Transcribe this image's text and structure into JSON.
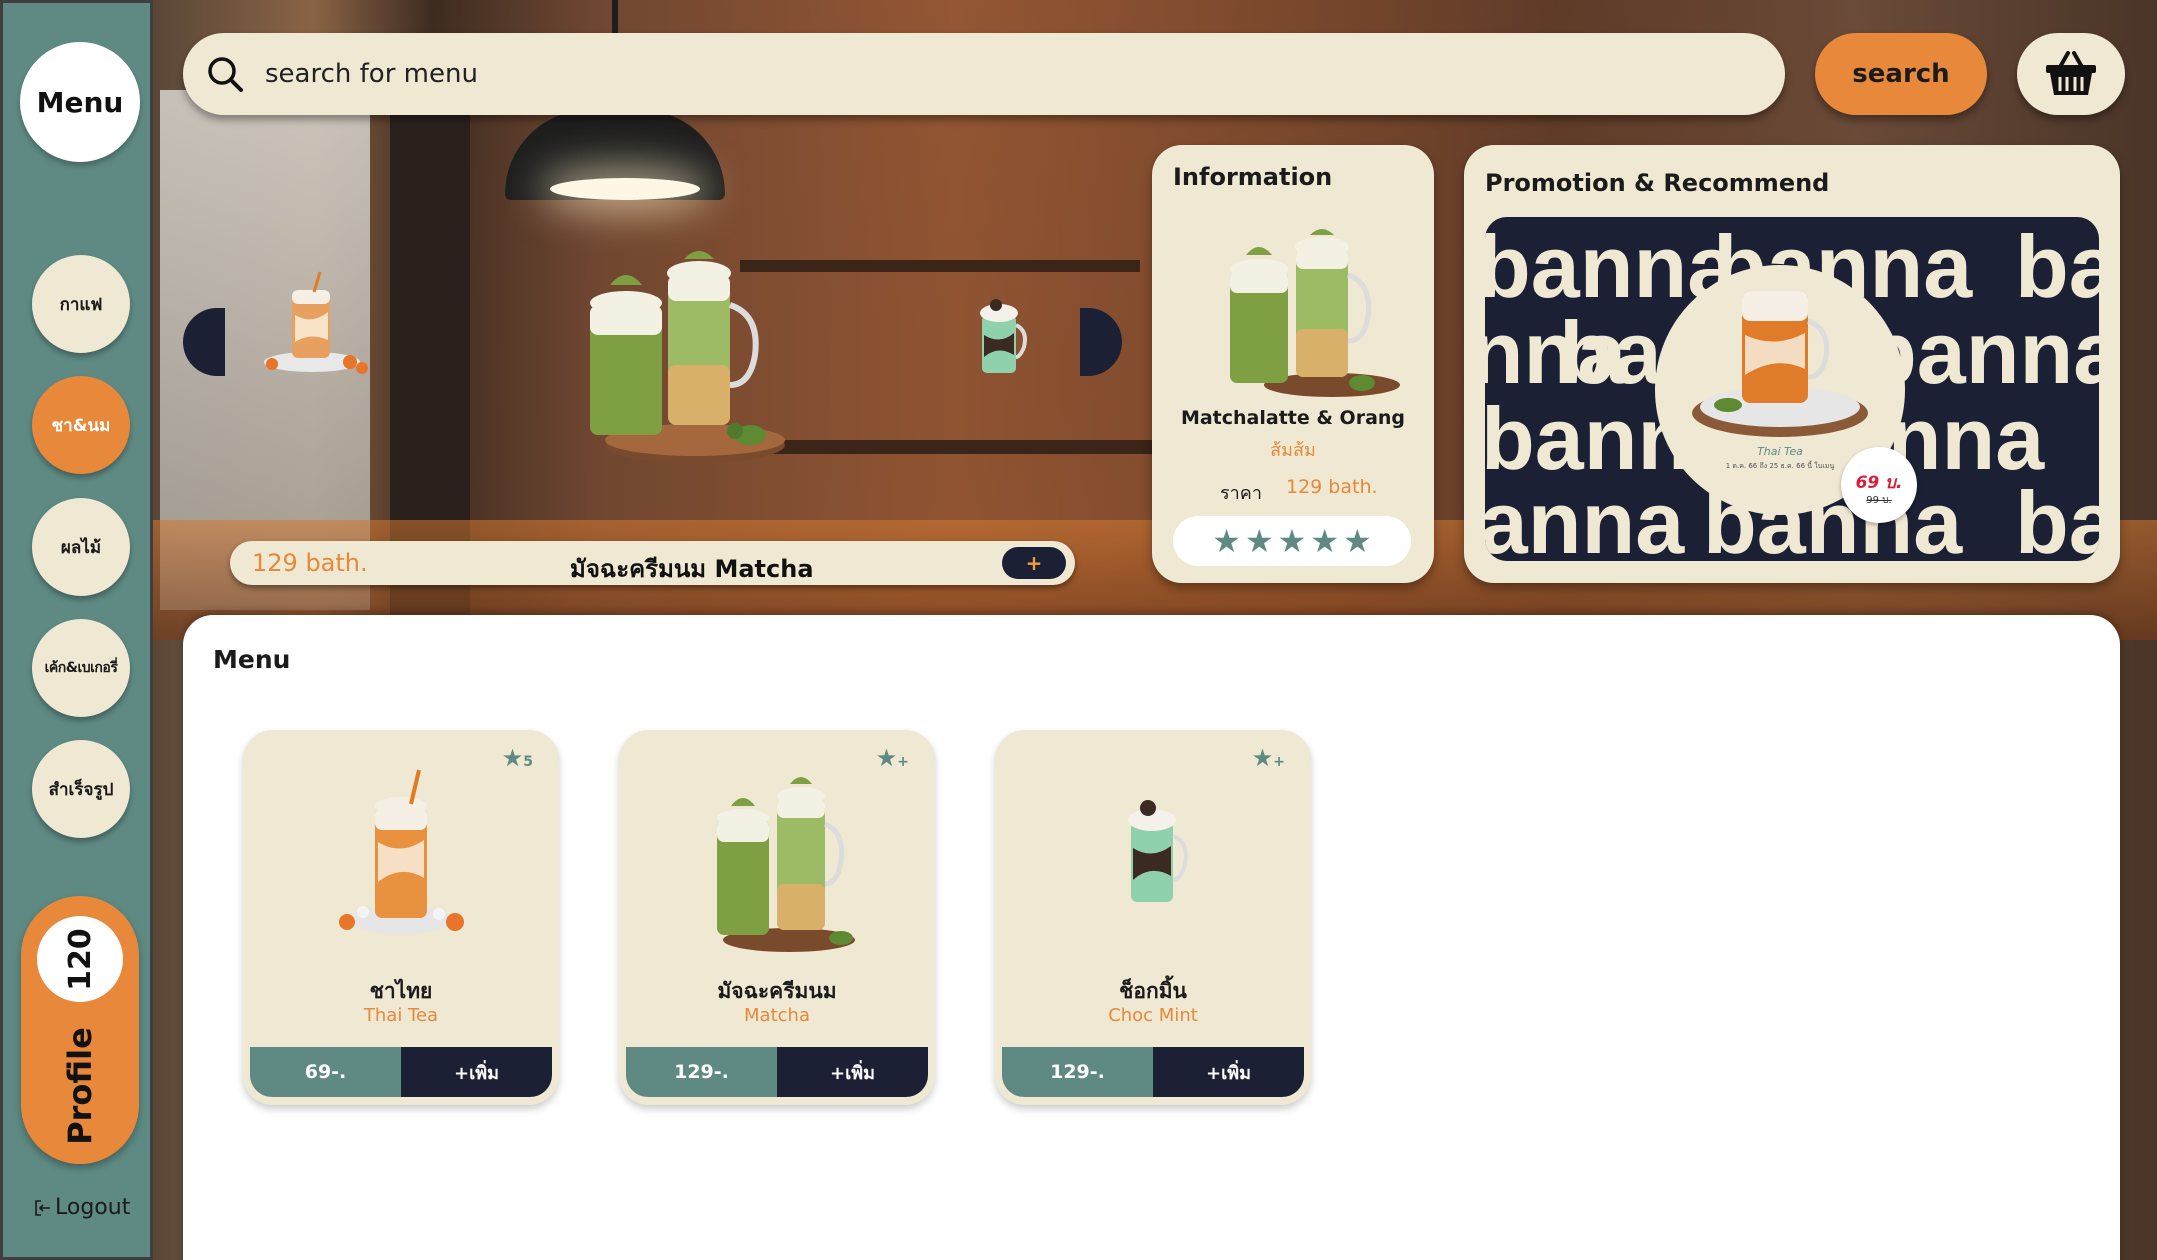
{
  "sidebar": {
    "logo": "Menu",
    "categories": [
      {
        "label": "กาแฟ",
        "active": false
      },
      {
        "label": "ชา&นม",
        "active": true
      },
      {
        "label": "ผลไม้",
        "active": false
      },
      {
        "label": "เค้ก&เบเกอรี่",
        "active": false
      },
      {
        "label": "สำเร็จรูป",
        "active": false
      }
    ],
    "profile": {
      "points": "120",
      "label": "Profile"
    },
    "logout": "Logout"
  },
  "search": {
    "placeholder": "search for menu",
    "button_label": "search"
  },
  "hero": {
    "price": "129 bath.",
    "name": "มัจฉะครีมนม Matcha",
    "add_label": "+"
  },
  "information": {
    "title": "Information",
    "name": "Matchalatte & Orang",
    "subname": "ส้มส้ม",
    "price_label": "ราคา",
    "price": "129 bath.",
    "rating": 5
  },
  "promotion": {
    "title": "Promotion & Recommend",
    "banner_word": "banna",
    "product_name": "Thai Tea",
    "date_text": "1 ต.ค. 66 ถึง 25 ธ.ค. 66 นี้ ในเมนู",
    "new_price": "69 บ.",
    "old_price": "99 บ."
  },
  "menu": {
    "title": "Menu",
    "items": [
      {
        "name": "ชาไทย",
        "subname": "Thai Tea",
        "price": "69-.",
        "add_label": "+เพิ่ม",
        "fav": "5"
      },
      {
        "name": "มัจฉะครีมนม",
        "subname": "Matcha",
        "price": "129-.",
        "add_label": "+เพิ่ม",
        "fav": "+"
      },
      {
        "name": "ช็อกมิ้น",
        "subname": "Choc Mint",
        "price": "129-.",
        "add_label": "+เพิ่ม",
        "fav": "+"
      }
    ]
  },
  "colors": {
    "sidebar": "#5f8a84",
    "cream": "#efe8d2",
    "accent": "#e8883a",
    "navy": "#1b2035"
  }
}
